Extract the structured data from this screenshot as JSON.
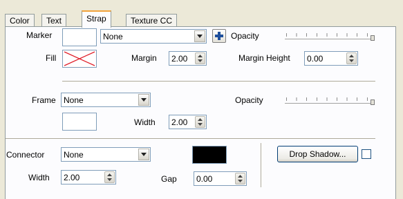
{
  "tabs": [
    {
      "label": "Color"
    },
    {
      "label": "Text"
    },
    {
      "label": "Strap",
      "active": true
    },
    {
      "label": "Texture CC"
    }
  ],
  "marker": {
    "label": "Marker",
    "combo_value": "None",
    "opacity_label": "Opacity"
  },
  "fill": {
    "label": "Fill",
    "margin_label": "Margin",
    "margin_value": "2.00",
    "margin_height_label": "Margin Height",
    "margin_height_value": "0.00"
  },
  "frame": {
    "label": "Frame",
    "combo_value": "None",
    "opacity_label": "Opacity",
    "width_label": "Width",
    "width_value": "2.00"
  },
  "connector": {
    "label": "Connector",
    "combo_value": "None",
    "color": "#000000",
    "width_label": "Width",
    "width_value": "2.00",
    "gap_label": "Gap",
    "gap_value": "0.00"
  },
  "drop_shadow": {
    "label": "Drop Shadow...",
    "checked": false
  },
  "colors": {
    "tab_highlight": "#f2a33b",
    "control_border": "#7f9db9",
    "plus_icon": "#1f4f9c",
    "fill_x": "#e0202a"
  }
}
